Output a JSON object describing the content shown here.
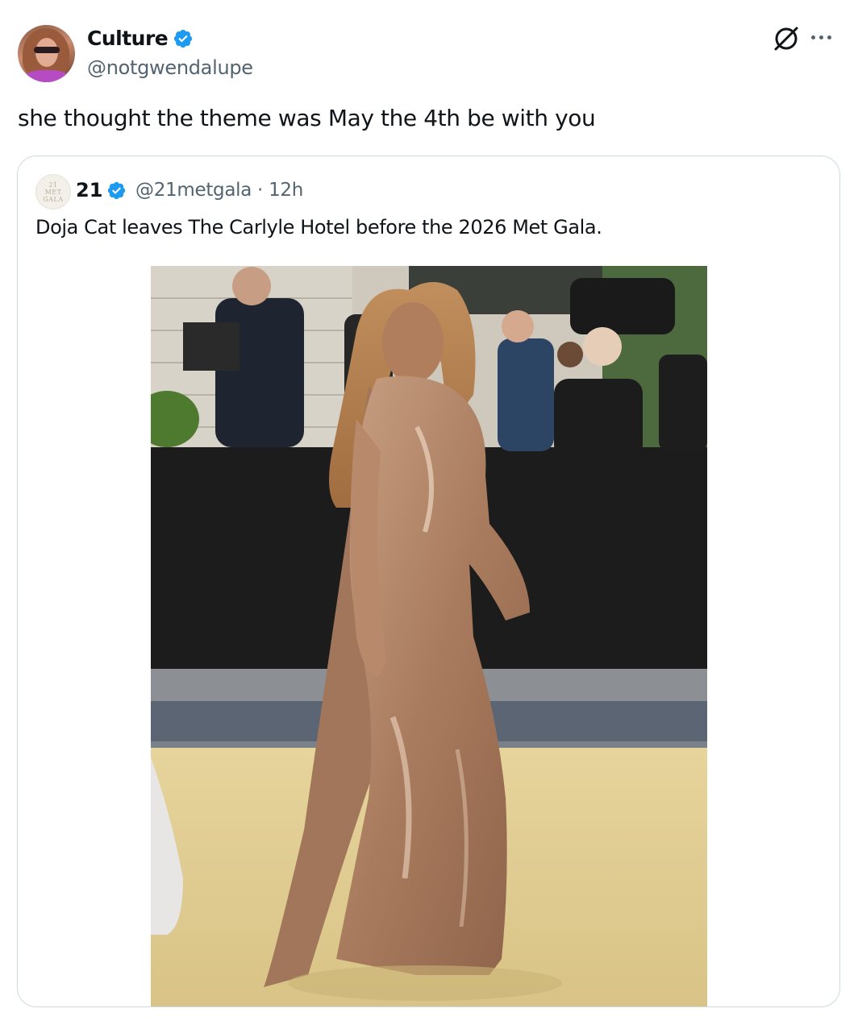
{
  "tweet": {
    "author_name": "Culture",
    "author_handle": "@notgwendalupe",
    "verified": true,
    "text": "she thought the theme was May the 4th be with you",
    "icons": [
      "grok-icon",
      "more-icon"
    ]
  },
  "quoted_tweet": {
    "author_name": "21",
    "author_handle": "@21metgala",
    "separator": "·",
    "time": "12h",
    "verified": true,
    "avatar_text": [
      "21",
      "MET",
      "GALA"
    ],
    "text": "Doja Cat leaves The Carlyle Hotel before the 2026 Met Gala."
  },
  "colors": {
    "text_primary": "#0f1419",
    "text_secondary": "#536471",
    "verified_blue": "#1d9bf0",
    "border": "#cfd9de"
  }
}
